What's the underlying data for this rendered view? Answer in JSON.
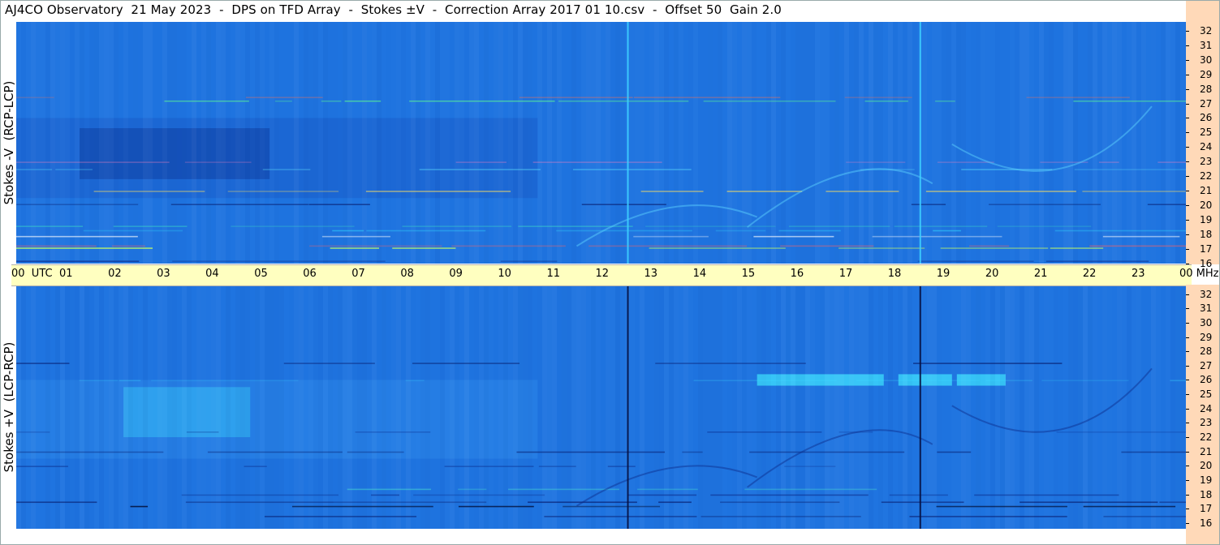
{
  "title": "AJ4CO Observatory  21 May 2023  -  DPS on TFD Array  -  Stokes ±V  -  Correction Array 2017 01 10.csv  -  Offset 50  Gain 2.0",
  "chart_data": [
    {
      "type": "heatmap",
      "panel": "top",
      "ylabel": "Stokes -V  (RCP-LCP)",
      "x_label": "UTC",
      "x_ticks": [
        "00",
        "01",
        "02",
        "03",
        "04",
        "05",
        "06",
        "07",
        "08",
        "09",
        "10",
        "11",
        "12",
        "13",
        "14",
        "15",
        "16",
        "17",
        "18",
        "19",
        "20",
        "21",
        "22",
        "23",
        "00"
      ],
      "y_unit": "MHz",
      "y_ticks": [
        16,
        17,
        18,
        19,
        20,
        21,
        22,
        23,
        24,
        25,
        26,
        27,
        28,
        29,
        30,
        31,
        32
      ],
      "ylim": [
        16,
        32.6
      ],
      "colors": {
        "background": "#1f74e0",
        "dark": "#0a2b8a",
        "bright": "#2fd1ff",
        "hot": "#ff4040"
      },
      "vertical_markers_utc": [
        12.55,
        18.55
      ],
      "marker_color": "#3ed0ff"
    },
    {
      "type": "heatmap",
      "panel": "bottom",
      "ylabel": "Stokes +V  (LCP-RCP)",
      "x_ticks": [
        "00",
        "01",
        "02",
        "03",
        "04",
        "05",
        "06",
        "07",
        "08",
        "09",
        "10",
        "11",
        "12",
        "13",
        "14",
        "15",
        "16",
        "17",
        "18",
        "19",
        "20",
        "21",
        "22",
        "23",
        "00"
      ],
      "y_unit": "MHz",
      "y_ticks": [
        16,
        17,
        18,
        19,
        20,
        21,
        22,
        23,
        24,
        25,
        26,
        27,
        28,
        29,
        30,
        31,
        32
      ],
      "ylim": [
        15.6,
        32.6
      ],
      "colors": {
        "background": "#1f74e0",
        "dark": "#081a5c",
        "bright": "#3fe0ff"
      },
      "vertical_markers_utc": [
        12.55,
        18.55
      ],
      "marker_color": "#051040"
    }
  ],
  "timebar": {
    "labels": [
      "00  UTC",
      "01",
      "02",
      "03",
      "04",
      "05",
      "06",
      "07",
      "08",
      "09",
      "10",
      "11",
      "12",
      "13",
      "14",
      "15",
      "16",
      "17",
      "18",
      "19",
      "20",
      "21",
      "22",
      "23",
      "00 MHz"
    ]
  }
}
